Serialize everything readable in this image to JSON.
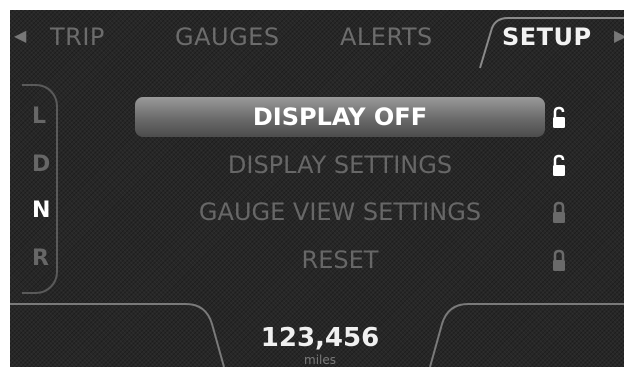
{
  "tabs": [
    {
      "label": "TRIP",
      "active": false
    },
    {
      "label": "GAUGES",
      "active": false
    },
    {
      "label": "ALERTS",
      "active": false
    },
    {
      "label": "SETUP",
      "active": true
    }
  ],
  "gear_selector": {
    "gears": [
      "L",
      "D",
      "N",
      "R"
    ],
    "selected": "N"
  },
  "menu": {
    "items": [
      {
        "label": "DISPLAY OFF",
        "selected": true,
        "lock": "unlocked"
      },
      {
        "label": "DISPLAY SETTINGS",
        "selected": false,
        "lock": "unlocked"
      },
      {
        "label": "GAUGE VIEW SETTINGS",
        "selected": false,
        "lock": "locked"
      },
      {
        "label": "RESET",
        "selected": false,
        "lock": "locked"
      }
    ]
  },
  "odometer": {
    "value": "123,456",
    "unit": "miles"
  },
  "colors": {
    "background": "#272727",
    "active_text": "#ffffff",
    "inactive_text": "#676767",
    "selection": "#8a8a8a"
  }
}
